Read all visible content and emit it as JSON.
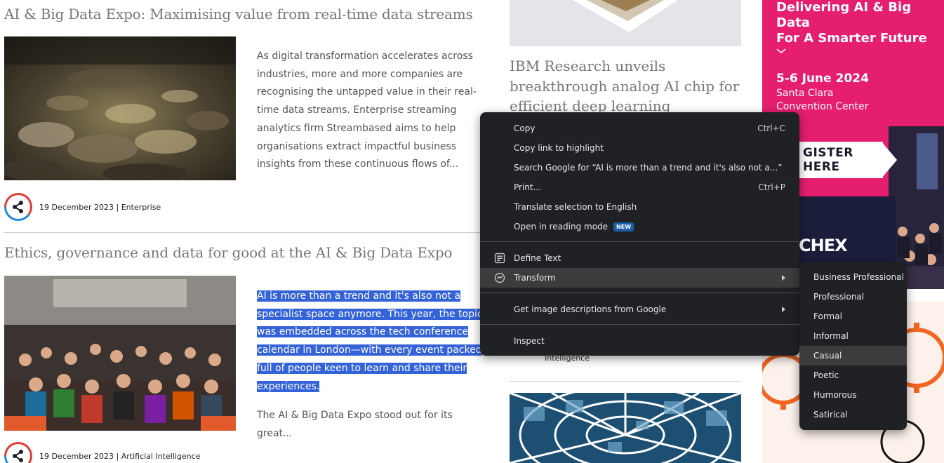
{
  "articles": [
    {
      "title": "AI & Big Data Expo: Maximising value from real-time data streams",
      "excerpt_lines": [
        "As digital transformation accelerates across",
        "industries, more and more companies are",
        "recognising the untapped value in their real-",
        "time data streams. Enterprise streaming",
        "analytics firm Streambased aims to help",
        "organisations extract impactful business",
        "insights from these continuous flows of..."
      ],
      "meta": "19 December 2023 | Enterprise"
    },
    {
      "title": "Ethics, governance and data for good at the AI & Big Data Expo",
      "selected_lines": [
        "AI is more than a trend and it's also not a",
        "specialist space anymore. This year, the topic",
        "was embedded across the tech conference",
        "calendar in London—with every event packed",
        "full of people keen to learn and share their",
        "experiences."
      ],
      "excerpt_tail": "The AI & Big Data Expo stood out for its great...",
      "meta": "19 December 2023 | Artificial Intelligence"
    }
  ],
  "middle": {
    "title_lines": [
      "IBM Research unveils",
      "breakthrough analog AI chip for",
      "efficient deep learning"
    ],
    "meta_fragment": "Intelligence"
  },
  "ad": {
    "headline_lines": [
      "Delivering AI & Big Data",
      "For A Smarter Future"
    ],
    "date": "5-6 June 2024",
    "venue_lines": [
      "Santa Clara",
      "Convention Center"
    ],
    "register": "GISTER HERE",
    "brand": "CHEX"
  },
  "context_menu": {
    "items": [
      {
        "label": "Copy",
        "shortcut": "Ctrl+C"
      },
      {
        "label": "Copy link to highlight"
      },
      {
        "label": "Search Google for “AI is more than a trend and it's also not a...”"
      },
      {
        "label": "Print...",
        "shortcut": "Ctrl+P"
      },
      {
        "label": "Translate selection to English"
      },
      {
        "label": "Open in reading mode",
        "badge": "NEW"
      },
      {
        "label": "Define Text",
        "icon": "define-text-icon"
      },
      {
        "label": "Transform",
        "icon": "transform-icon",
        "has_submenu": true
      },
      {
        "label": "Get image descriptions from Google",
        "has_submenu": true
      },
      {
        "label": "Inspect"
      }
    ]
  },
  "submenu": {
    "items": [
      "Business Professional",
      "Professional",
      "Formal",
      "Informal",
      "Casual",
      "Poetic",
      "Humorous",
      "Satirical"
    ],
    "highlighted": "Casual"
  },
  "colors": {
    "selection": "#3462d8",
    "ad_pink": "#e51e6f",
    "menu_bg": "#202124"
  }
}
